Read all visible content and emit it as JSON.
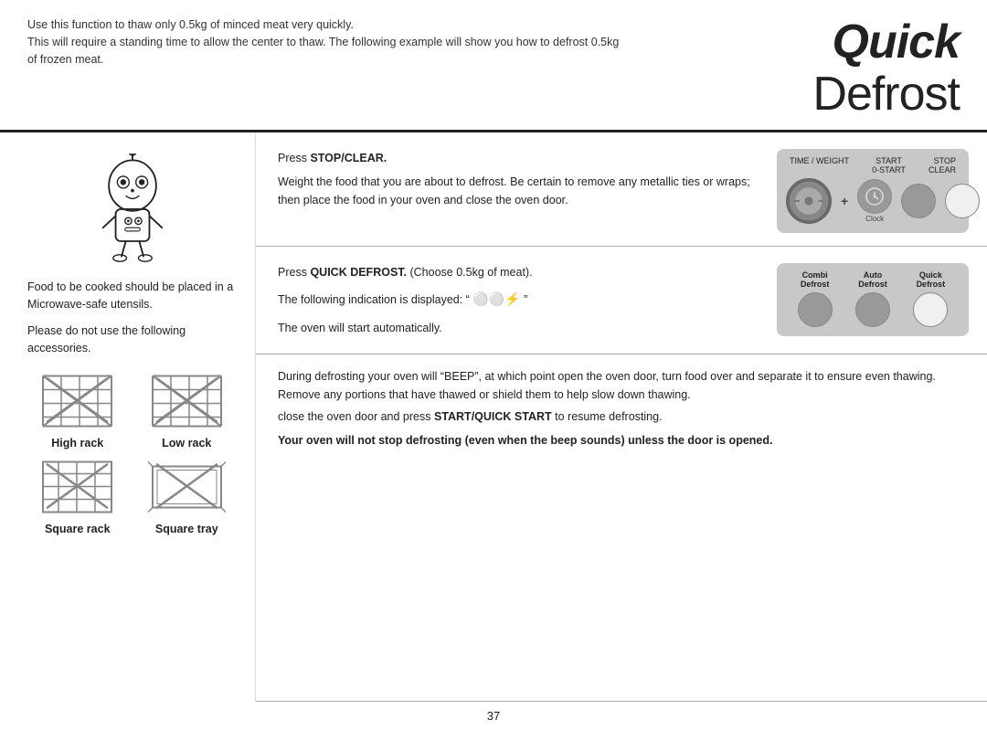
{
  "header": {
    "line1": "Use this function to thaw only 0.5kg of minced meat very quickly.",
    "line2": "This will require a standing time to allow the center to thaw. The following example will show you how to defrost 0.5kg",
    "line3": "of frozen meat.",
    "title_quick": "Quick",
    "title_defrost": "Defrost"
  },
  "left": {
    "para1": "Food to be cooked should be placed in a Microwave-safe utensils.",
    "para2": "Please do not use the following accessories.",
    "racks": [
      {
        "label": "High rack"
      },
      {
        "label": "Low rack"
      },
      {
        "label": "Square rack"
      },
      {
        "label": "Square tray"
      }
    ]
  },
  "steps": {
    "step1": {
      "press": "Press ",
      "bold": "STOP/CLEAR.",
      "body": "Weight the food that you are about to defrost. Be certain to remove any metallic ties or wraps; then place the food in your oven and close the oven door."
    },
    "step2": {
      "line1_pre": "Press ",
      "line1_bold": "QUICK DEFROST.",
      "line1_post": " (Choose 0.5kg of meat).",
      "line2_pre": "The following indication is displayed: “ ",
      "line2_symbol": "⚪⚪⚡",
      "line2_post": " ”",
      "line3": "The oven will start automatically."
    },
    "step3": {
      "line1": "During defrosting your oven will “BEEP”, at which point open the oven door, turn food over and separate it to ensure even thawing. Remove any portions that have thawed or shield them to help slow down thawing.",
      "line2_pre": "close the oven door and press ",
      "line2_bold": "START/QUICK START",
      "line2_post": " to resume defrosting.",
      "line3_bold": "Your oven will not stop defrosting (even when the beep sounds) unless the door is opened."
    }
  },
  "panel1": {
    "label_time": "TIME / WEIGHT",
    "label_start": "START",
    "label_0start": "0-START",
    "label_stop": "STOP",
    "label_clear": "CLEAR",
    "label_clock": "Clock"
  },
  "panel2": {
    "label_combi": "Combi",
    "label_combi2": "Defrost",
    "label_auto": "Auto",
    "label_auto2": "Defrost",
    "label_quick": "Quick",
    "label_quick2": "Defrost"
  },
  "page": {
    "number": "37"
  }
}
